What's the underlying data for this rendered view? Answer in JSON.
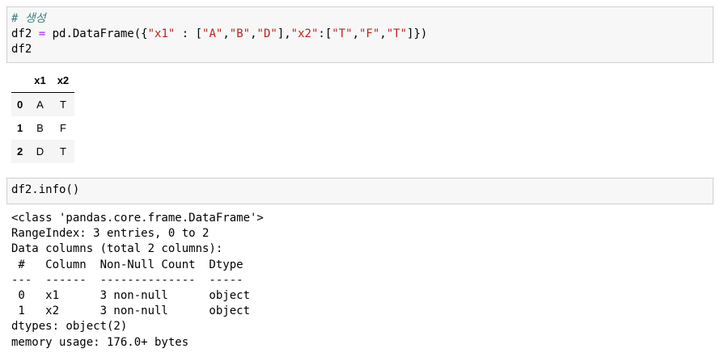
{
  "cell1": {
    "comment": "# 생성",
    "line2": {
      "var": "df2",
      "eq": " = ",
      "call": "pd.DataFrame({",
      "k1": "\"x1\"",
      "sep1": " : [",
      "a": "\"A\"",
      "c1": ",",
      "b": "\"B\"",
      "c2": ",",
      "d": "\"D\"",
      "close1": "],",
      "k2": "\"x2\"",
      "sep2": ":[",
      "t1": "\"T\"",
      "c3": ",",
      "f": "\"F\"",
      "c4": ",",
      "t2": "\"T\"",
      "close2": "]})"
    },
    "line3": "df2"
  },
  "table": {
    "columns": [
      "x1",
      "x2"
    ],
    "rows": [
      {
        "index": "0",
        "x1": "A",
        "x2": "T"
      },
      {
        "index": "1",
        "x1": "B",
        "x2": "F"
      },
      {
        "index": "2",
        "x1": "D",
        "x2": "T"
      }
    ]
  },
  "cell2": {
    "code": "df2.info()"
  },
  "output": {
    "lines": [
      "<class 'pandas.core.frame.DataFrame'>",
      "RangeIndex: 3 entries, 0 to 2",
      "Data columns (total 2 columns):",
      " #   Column  Non-Null Count  Dtype ",
      "---  ------  --------------  ----- ",
      " 0   x1      3 non-null      object",
      " 1   x2      3 non-null      object",
      "dtypes: object(2)",
      "memory usage: 176.0+ bytes"
    ]
  }
}
